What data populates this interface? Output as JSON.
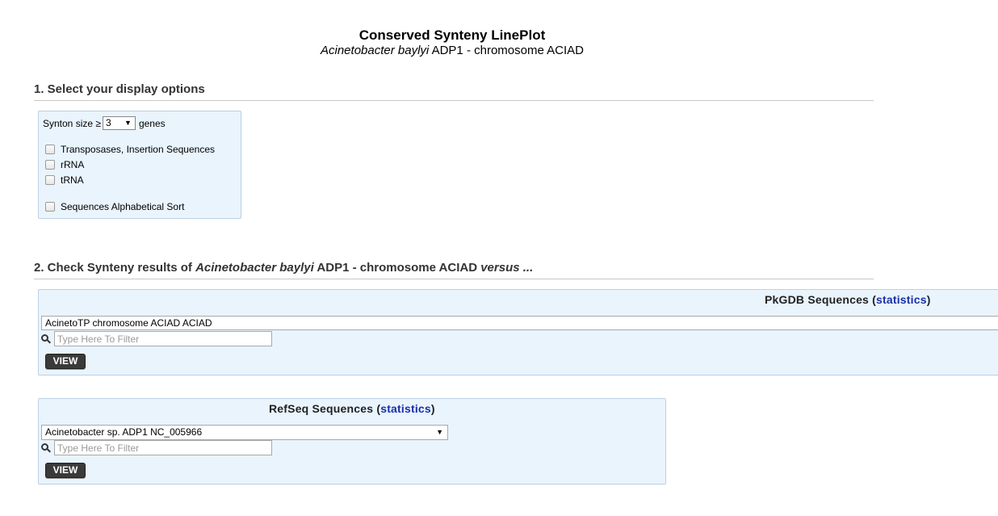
{
  "header": {
    "title": "Conserved Synteny LinePlot",
    "subtitle_organism": "Acinetobacter baylyi",
    "subtitle_rest": " ADP1 - chromosome ACIAD"
  },
  "section1": {
    "heading": "1. Select your display options",
    "synton_label": "Synton size ≥",
    "synton_value": "3",
    "synton_unit": "genes",
    "checkboxes": [
      {
        "label": "Transposases, Insertion Sequences",
        "checked": false
      },
      {
        "label": "rRNA",
        "checked": false
      },
      {
        "label": "tRNA",
        "checked": false
      },
      {
        "label": "Sequences Alphabetical Sort",
        "checked": false
      }
    ]
  },
  "section2": {
    "heading_prefix": "2. Check Synteny results of ",
    "heading_organism": "Acinetobacter baylyi",
    "heading_middle": " ADP1 - chromosome ACIAD ",
    "heading_versus": "versus ...",
    "pkgdb": {
      "title": "PkGDB Sequences (",
      "link": "statistics",
      "title_end": ")",
      "selected": "AcinetoTP chromosome ACIAD ACIAD",
      "filter_placeholder": "Type Here To Filter",
      "view_label": "VIEW"
    },
    "refseq": {
      "title": "RefSeq Sequences (",
      "link": "statistics",
      "title_end": ")",
      "selected": "Acinetobacter sp. ADP1 NC_005966",
      "filter_placeholder": "Type Here To Filter",
      "view_label": "VIEW"
    }
  },
  "icons": {
    "dropdown": "caret-down-icon",
    "search": "search-icon"
  },
  "colors": {
    "panel_bg": "#e9f4fd",
    "link": "#1a2fa8",
    "button_bg": "#3a3a3a"
  }
}
